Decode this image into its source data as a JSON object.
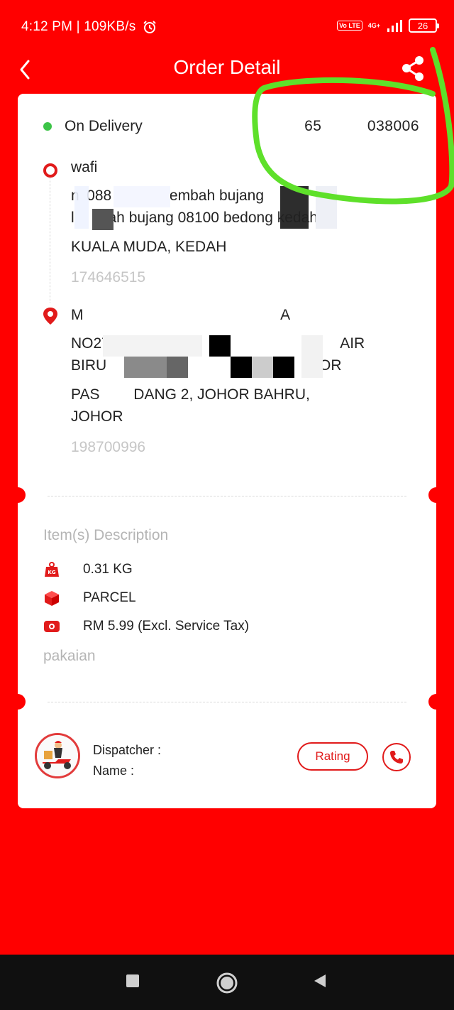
{
  "status_bar": {
    "time": "4:12 PM | 109KB/s",
    "volte": "Vo LTE",
    "network": "4G+",
    "battery": "26"
  },
  "header": {
    "title": "Order Detail"
  },
  "order": {
    "status": "On Delivery",
    "tracking_no": "65   038006"
  },
  "sender": {
    "name": "wafi",
    "address_line1": "n 088   an lembah bujang   ",
    "address_line2": "l   ah bujang 08100 bedong kedah",
    "city": "KUALA MUDA, KEDAH",
    "phone": "174646515"
  },
  "receiver": {
    "name": "M              A",
    "address_line1": "NO27 PERJIRAN           AIR",
    "address_line2": "BIRU               OR",
    "city_line1": "PAS   DANG 2, JOHOR BAHRU,",
    "city_line2": "JOHOR",
    "phone": "198700996"
  },
  "items": {
    "label": "Item(s) Description",
    "weight": "0.31 KG",
    "type": "PARCEL",
    "price": "RM 5.99 (Excl. Service Tax)",
    "remark": "pakaian"
  },
  "dispatcher": {
    "label": "Dispatcher :",
    "name_label": "Name :",
    "rating_label": "Rating"
  },
  "icons": {
    "back": "chevron-left-icon",
    "share": "share-icon",
    "weight": "kg-weight-icon",
    "parcel": "parcel-box-icon",
    "price": "money-icon",
    "call": "phone-icon"
  },
  "colors": {
    "brand_red": "#ff0000",
    "status_green": "#3cc447",
    "annotation_green": "#5ee02a"
  }
}
